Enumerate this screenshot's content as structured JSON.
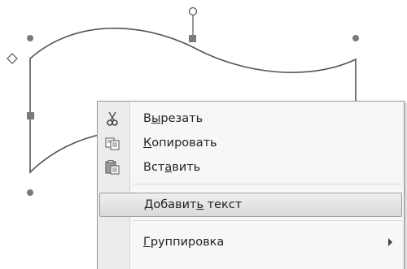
{
  "canvas": {
    "shape": "wave-shape",
    "handles": [
      "top-left",
      "top-center-rotate",
      "top-right",
      "middle-left",
      "middle-right",
      "bottom-left",
      "adjust-diamond"
    ]
  },
  "menu": {
    "items": [
      {
        "label_pre": "В",
        "label_mnemonic": "ы",
        "label_post": "резать",
        "icon": "scissors-icon"
      },
      {
        "label_pre": "",
        "label_mnemonic": "К",
        "label_post": "опировать",
        "icon": "copy-icon"
      },
      {
        "label_pre": "Вст",
        "label_mnemonic": "а",
        "label_post": "вить",
        "icon": "paste-icon"
      },
      {
        "label_pre": "Добавит",
        "label_mnemonic": "ь",
        "label_post": " текст",
        "icon": ""
      },
      {
        "label_pre": "",
        "label_mnemonic": "Г",
        "label_post": "руппировка",
        "icon": "",
        "has_submenu": true
      }
    ]
  },
  "colors": {
    "menu_bg": "#f7f7f7",
    "highlight": "#dcdcdc",
    "handle": "#7a7a7a"
  }
}
